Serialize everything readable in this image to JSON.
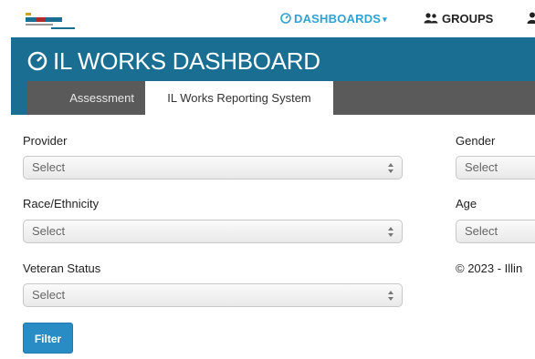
{
  "nav": {
    "dashboards_label": "DASHBOARDS",
    "groups_label": "GROUPS"
  },
  "header": {
    "title": "IL WORKS DASHBOARD"
  },
  "tabs": [
    {
      "label": "Assessment",
      "active": false
    },
    {
      "label": "IL Works Reporting System",
      "active": true
    }
  ],
  "filters": {
    "provider": {
      "label": "Provider",
      "value": "Select"
    },
    "race": {
      "label": "Race/Ethnicity",
      "value": "Select"
    },
    "veteran": {
      "label": "Veteran Status",
      "value": "Select"
    },
    "gender": {
      "label": "Gender",
      "value": "Select"
    },
    "age": {
      "label": "Age",
      "value": "Select"
    },
    "filter_button": "Filter"
  },
  "footer": {
    "copyright": "© 2023 - Illin"
  },
  "colors": {
    "accent": "#2fa3d6",
    "header_bg": "#1a6e92",
    "tab_strip": "#5a5a5a",
    "button": "#2a8cc4"
  }
}
